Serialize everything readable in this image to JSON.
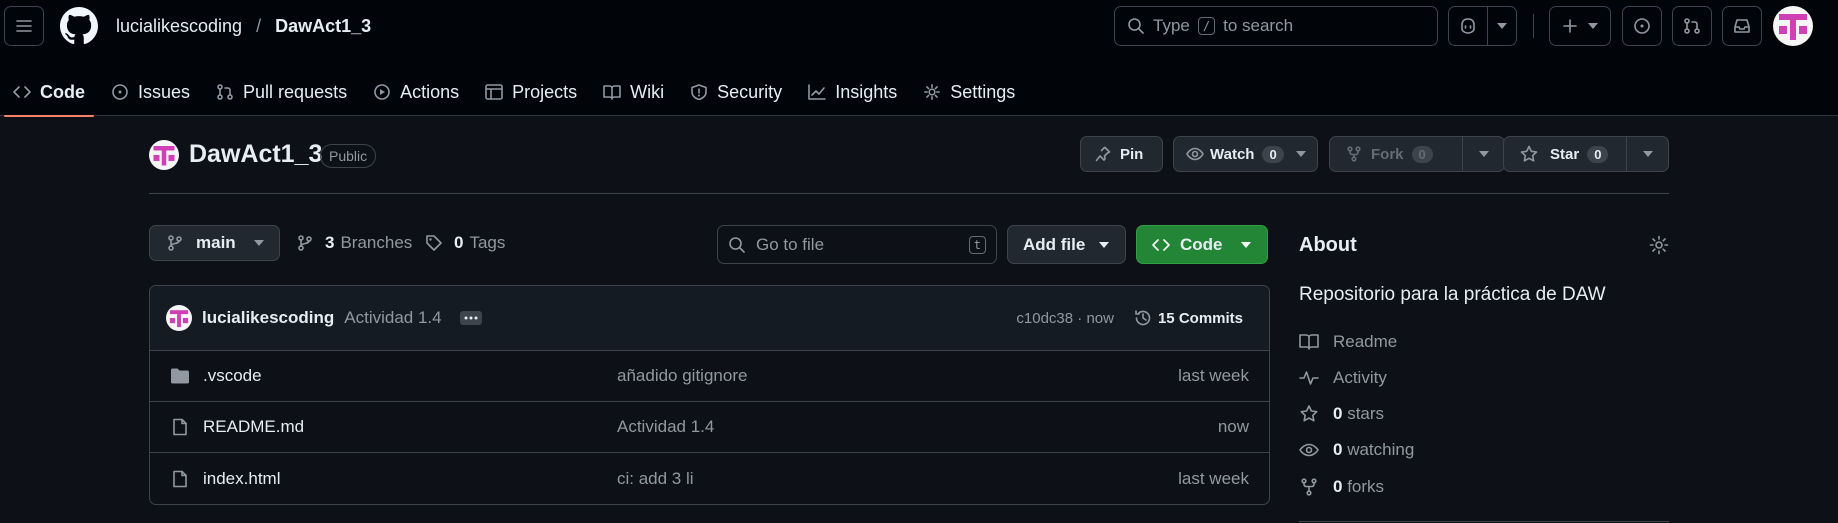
{
  "header": {
    "owner": "lucialikescoding",
    "separator": "/",
    "repo": "DawAct1_3",
    "search_prefix": "Type",
    "search_key": "/",
    "search_suffix": "to search"
  },
  "tabs": [
    {
      "label": "Code",
      "icon": "code-icon"
    },
    {
      "label": "Issues",
      "icon": "issue-icon"
    },
    {
      "label": "Pull requests",
      "icon": "pull-request-icon"
    },
    {
      "label": "Actions",
      "icon": "play-icon"
    },
    {
      "label": "Projects",
      "icon": "table-icon"
    },
    {
      "label": "Wiki",
      "icon": "book-icon"
    },
    {
      "label": "Security",
      "icon": "shield-icon"
    },
    {
      "label": "Insights",
      "icon": "graph-icon"
    },
    {
      "label": "Settings",
      "icon": "gear-icon"
    }
  ],
  "repo": {
    "name": "DawAct1_3",
    "visibility": "Public",
    "pin_label": "Pin",
    "watch_label": "Watch",
    "watch_count": "0",
    "fork_label": "Fork",
    "fork_count": "0",
    "star_label": "Star",
    "star_count": "0"
  },
  "toolbar": {
    "branch": "main",
    "branches_count": "3",
    "branches_label": "Branches",
    "tags_count": "0",
    "tags_label": "Tags",
    "goto_placeholder": "Go to file",
    "goto_key": "t",
    "add_file_label": "Add file",
    "code_label": "Code"
  },
  "commit": {
    "author": "lucialikescoding",
    "message": "Actividad 1.4",
    "hash_time": "c10dc38 · now",
    "commits_label": "15 Commits"
  },
  "files": [
    {
      "name": ".vscode",
      "type": "folder",
      "message": "añadido gitignore",
      "time": "last week"
    },
    {
      "name": "README.md",
      "type": "file",
      "message": "Actividad 1.4",
      "time": "now"
    },
    {
      "name": "index.html",
      "type": "file",
      "message": "ci: add 3 li",
      "time": "last week"
    }
  ],
  "about": {
    "title": "About",
    "description": "Repositorio para la práctica de DAW",
    "readme": "Readme",
    "activity": "Activity",
    "stars_count": "0",
    "stars_label": "stars",
    "watching_count": "0",
    "watching_label": "watching",
    "forks_count": "0",
    "forks_label": "forks"
  },
  "colors": {
    "accent": "#f78166",
    "green": "#238636",
    "bg": "#0d1117",
    "header_bg": "#010409"
  }
}
